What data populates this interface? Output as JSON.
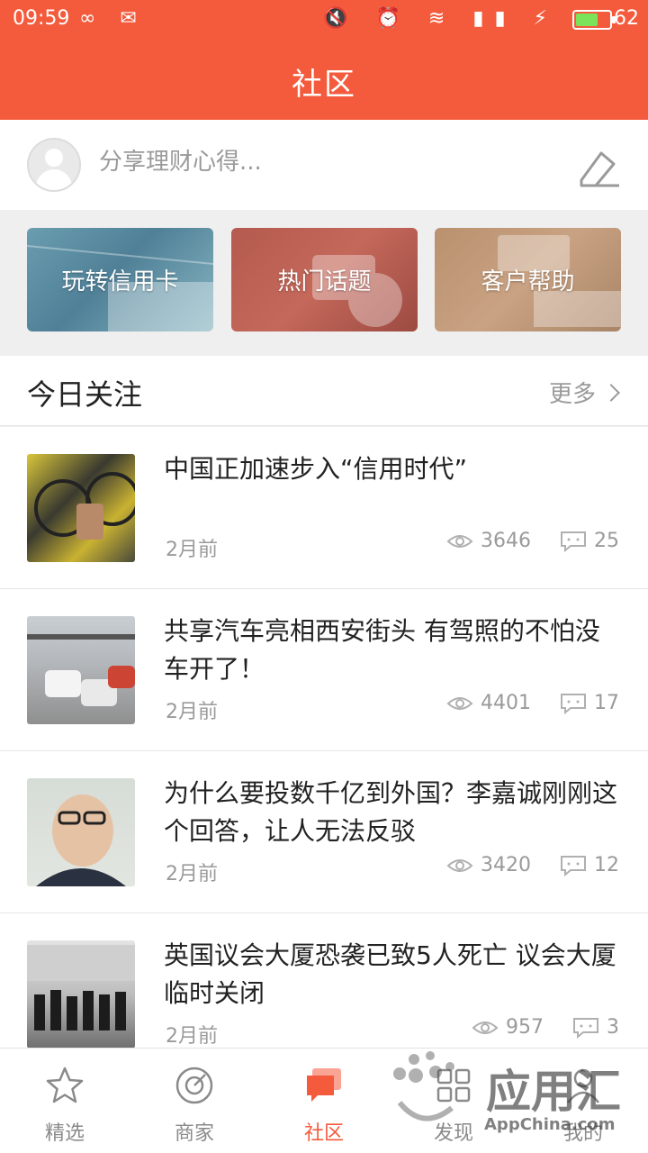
{
  "status_bar": {
    "time": "09:59",
    "battery": "62"
  },
  "header": {
    "title": "社区"
  },
  "share": {
    "placeholder": "分享理财心得..."
  },
  "categories": [
    {
      "label": "玩转信用卡"
    },
    {
      "label": "热门话题"
    },
    {
      "label": "客户帮助"
    }
  ],
  "section": {
    "title": "今日关注",
    "more_label": "更多"
  },
  "news": [
    {
      "title": "中国正加速步入“信用时代”",
      "time": "2月前",
      "views": "3646",
      "comments": "25"
    },
    {
      "title": "共享汽车亮相西安街头 有驾照的不怕没车开了！",
      "time": "2月前",
      "views": "4401",
      "comments": "17"
    },
    {
      "title": "为什么要投数千亿到外国？李嘉诚刚刚这个回答，让人无法反驳",
      "time": "2月前",
      "views": "3420",
      "comments": "12"
    },
    {
      "title": "英国议会大厦恐袭已致5人死亡 议会大厦临时关闭",
      "time": "2月前",
      "views": "957",
      "comments": "3"
    }
  ],
  "tabs": [
    {
      "label": "精选"
    },
    {
      "label": "商家"
    },
    {
      "label": "社区"
    },
    {
      "label": "发现"
    },
    {
      "label": "我的"
    }
  ],
  "watermark": {
    "text": "应用汇",
    "sub": "AppChina.com"
  },
  "colors": {
    "accent": "#f45a3c",
    "muted": "#9a9a9a",
    "text": "#222222"
  }
}
